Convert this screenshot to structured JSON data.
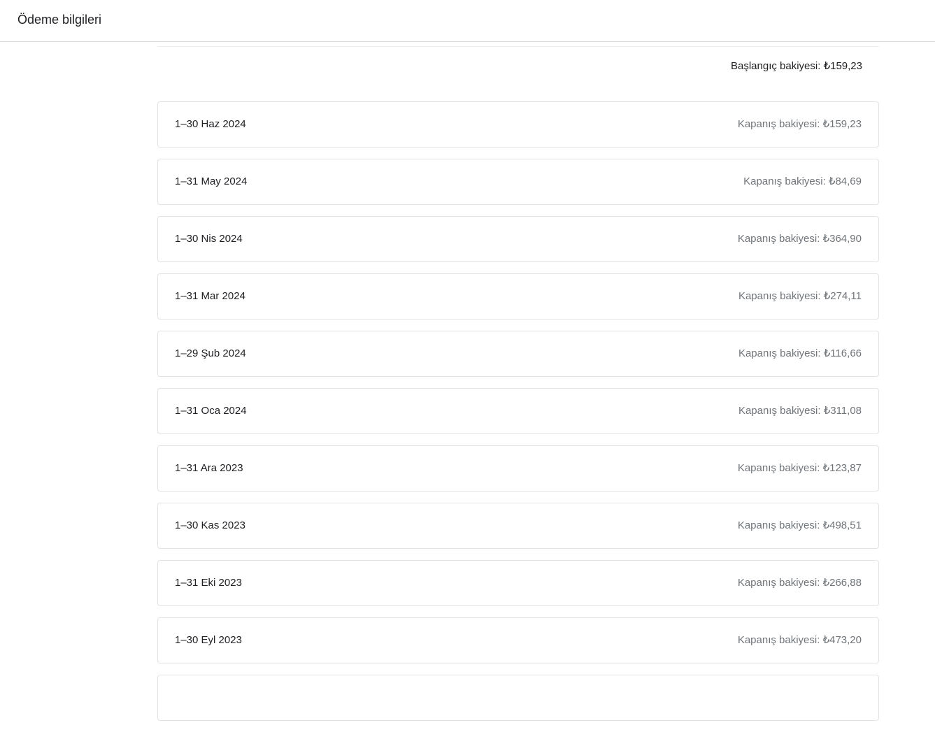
{
  "header": {
    "title": "Ödeme bilgileri"
  },
  "summary": {
    "opening_balance_label": "Başlangıç bakiyesi: ₺159,23"
  },
  "statements": [
    {
      "period": "1–30 Haz 2024",
      "closing": "Kapanış bakiyesi: ₺159,23"
    },
    {
      "period": "1–31 May 2024",
      "closing": "Kapanış bakiyesi: ₺84,69"
    },
    {
      "period": "1–30 Nis 2024",
      "closing": "Kapanış bakiyesi: ₺364,90"
    },
    {
      "period": "1–31 Mar 2024",
      "closing": "Kapanış bakiyesi: ₺274,11"
    },
    {
      "period": "1–29 Şub 2024",
      "closing": "Kapanış bakiyesi: ₺116,66"
    },
    {
      "period": "1–31 Oca 2024",
      "closing": "Kapanış bakiyesi: ₺311,08"
    },
    {
      "period": "1–31 Ara 2023",
      "closing": "Kapanış bakiyesi: ₺123,87"
    },
    {
      "period": "1–30 Kas 2023",
      "closing": "Kapanış bakiyesi: ₺498,51"
    },
    {
      "period": "1–31 Eki 2023",
      "closing": "Kapanış bakiyesi: ₺266,88"
    },
    {
      "period": "1–30 Eyl 2023",
      "closing": "Kapanış bakiyesi: ₺473,20"
    },
    {
      "period": "",
      "closing": ""
    }
  ]
}
